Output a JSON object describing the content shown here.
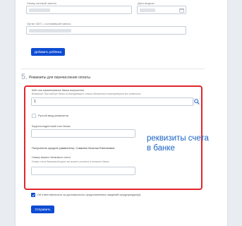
{
  "form": {
    "act_number_label": "Номер актовой записи",
    "act_date_label": "Дата выдачи",
    "zags_label": "Орган ЗАГС, составивший запись",
    "add_child_button": "Добавить ребёнка"
  },
  "bank_section": {
    "number": "5.",
    "title": "Реквизиты для перечисления оплаты",
    "bik_label": "БИК или наименование банка получателя",
    "bik_note": "Внимание! При выборе банка из выпадающего списка обязательно перепроверьте все реквизиты.",
    "bik_value": "1",
    "manual_checkbox_label": "Ручной ввод реквизитов",
    "corr_account_label": "Корреспондентский счет банка",
    "recipient_text": "Получатель средств (заявитель): Савкина Наталья Евгеньевна",
    "account_label": "Номер вашего банкового счета",
    "account_note": "Номер счета банковской карты вы можете уточнить в интернет-банке"
  },
  "annotation": {
    "line1": "реквизиты счета",
    "line2": "в банке",
    "color": "#1a63c4"
  },
  "consent": {
    "label": "Об ответственности за достоверность представленных сведений предупрежден(а)",
    "checked": true
  },
  "submit_button": "Отправить",
  "colors": {
    "accent": "#0d4cd3",
    "highlight_border": "#e3252c"
  }
}
